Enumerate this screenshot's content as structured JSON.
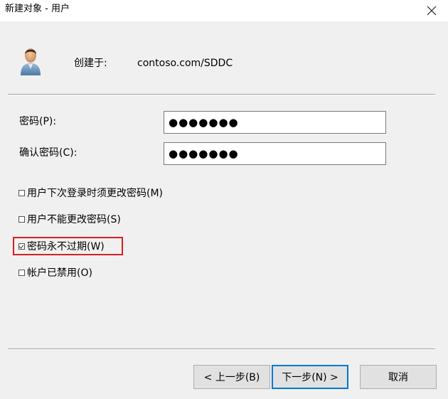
{
  "window": {
    "title": "新建对象 - 用户",
    "close_glyph": "✕"
  },
  "header": {
    "icon": "user-icon",
    "created_in_label": "创建于:",
    "created_in_value": "contoso.com/SDDC"
  },
  "form": {
    "password_label": "密码(P):",
    "password_value": "●●●●●●●",
    "confirm_label": "确认密码(C):",
    "confirm_value": "●●●●●●●"
  },
  "options": [
    {
      "label": "用户下次登录时须更改密码(M)",
      "checked": false
    },
    {
      "label": "用户不能更改密码(S)",
      "checked": false
    },
    {
      "label": "密码永不过期(W)",
      "checked": true
    },
    {
      "label": "帐户已禁用(O)",
      "checked": false
    }
  ],
  "buttons": {
    "back": "< 上一步(B)",
    "next": "下一步(N) >",
    "cancel": "取消"
  },
  "colors": {
    "highlight": "#d81e1e",
    "default_button_border": "#0078d7"
  }
}
